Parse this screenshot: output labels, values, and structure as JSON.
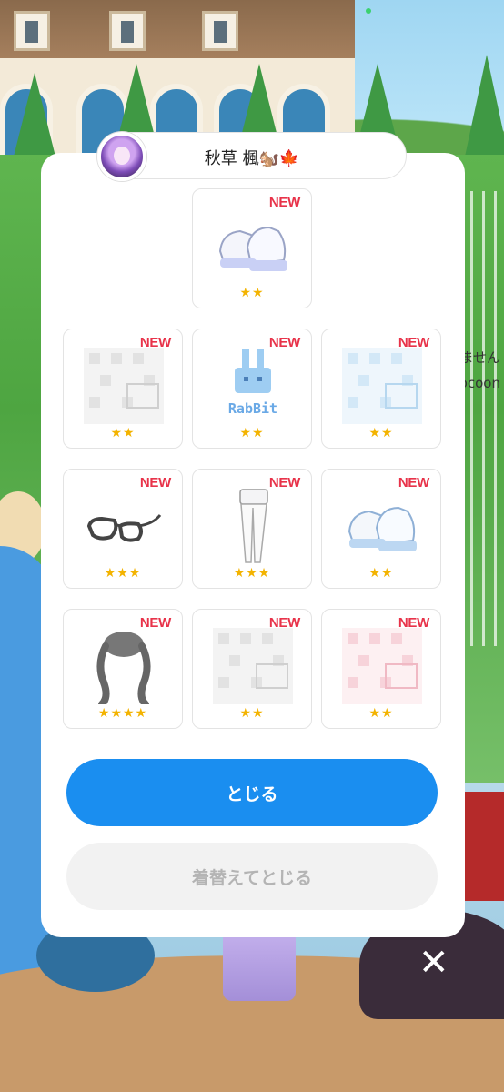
{
  "player": {
    "name": "秋草 楓🐿️🍁"
  },
  "items": [
    {
      "badge": "NEW",
      "stars": "★★",
      "icon": "sneakers-icon"
    },
    {
      "badge": "NEW",
      "stars": "★★",
      "icon": "game-shirt-gray-icon"
    },
    {
      "badge": "NEW",
      "stars": "★★",
      "icon": "rabbit-logo-icon"
    },
    {
      "badge": "NEW",
      "stars": "★★",
      "icon": "game-shirt-blue-icon"
    },
    {
      "badge": "NEW",
      "stars": "★★★",
      "icon": "glasses-icon"
    },
    {
      "badge": "NEW",
      "stars": "★★★",
      "icon": "shorts-tights-icon"
    },
    {
      "badge": "NEW",
      "stars": "★★",
      "icon": "sneakers-icon"
    },
    {
      "badge": "NEW",
      "stars": "★★★★",
      "icon": "twin-tail-hair-icon"
    },
    {
      "badge": "NEW",
      "stars": "★★",
      "icon": "game-shirt-gray-icon"
    },
    {
      "badge": "NEW",
      "stars": "★★",
      "icon": "game-shirt-pink-icon"
    }
  ],
  "rabbit_logo_text": "RabBit",
  "buttons": {
    "close": "とじる",
    "change_and_close": "着替えてとじる"
  },
  "background_text": {
    "line1": "ません",
    "line2": "ocoon"
  },
  "colors": {
    "primary": "#1a8ef0",
    "new_badge": "#e8334a",
    "star": "#f3b300"
  }
}
